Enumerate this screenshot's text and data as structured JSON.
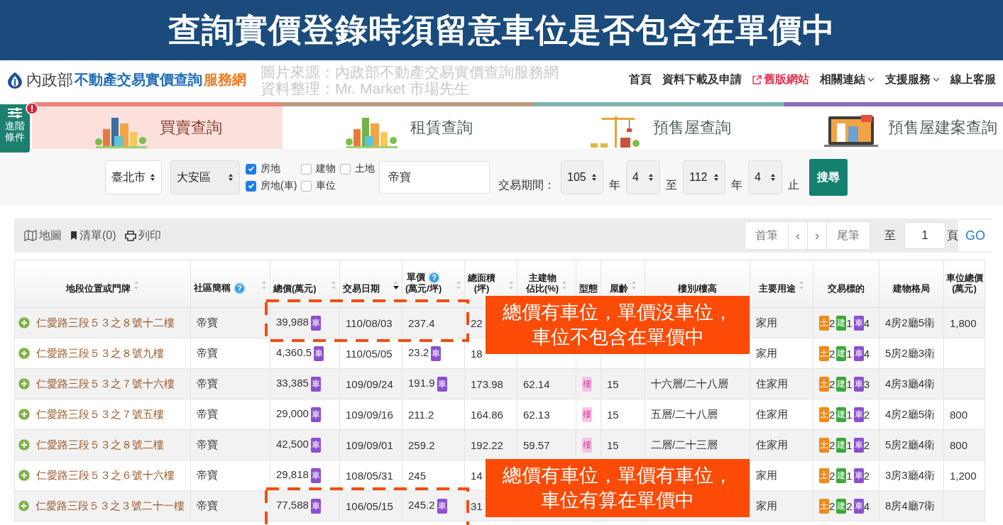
{
  "banner": {
    "title": "查詢實價登錄時須留意車位是否包含在單價中"
  },
  "header": {
    "logo_org": "內政部",
    "logo_main": "不動產交易實價查詢",
    "logo_suffix": "服務網",
    "credits": [
      "圖片來源：內政部不動產交易實價查詢服務網",
      "資料整理：Mr. Market 市場先生"
    ],
    "nav": [
      {
        "label": "首頁",
        "kind": "plain"
      },
      {
        "label": "資料下載及申請",
        "kind": "plain"
      },
      {
        "label": "舊版網站",
        "kind": "external"
      },
      {
        "label": "相關連結",
        "kind": "dropdown"
      },
      {
        "label": "支援服務",
        "kind": "dropdown"
      },
      {
        "label": "線上客服",
        "kind": "plain"
      }
    ]
  },
  "advanced": {
    "label": "進階條件",
    "alert": true
  },
  "tabs": [
    {
      "label": "買賣查詢",
      "selected": true,
      "color": "#e8847c"
    },
    {
      "label": "租賃查詢",
      "selected": false,
      "color": "#b99a7a"
    },
    {
      "label": "預售屋查詢",
      "selected": false,
      "color": "#7fb6ad"
    },
    {
      "label": "預售屋建案查詢",
      "selected": false,
      "color": "#8c6bc0"
    }
  ],
  "form": {
    "city": "臺北市",
    "district": "大安區",
    "types": [
      {
        "label": "房地",
        "checked": true
      },
      {
        "label": "建物",
        "checked": false
      },
      {
        "label": "土地",
        "checked": false
      },
      {
        "label": "房地(車)",
        "checked": true
      },
      {
        "label": "車位",
        "checked": false
      }
    ],
    "keyword": "帝寶",
    "period_label": "交易期間：",
    "from_year": "105",
    "year_unit_1": "年",
    "from_month": "4",
    "to_label": "至",
    "to_year": "112",
    "year_unit_2": "年",
    "to_month": "4",
    "end_label": "止",
    "search_button": "搜尋"
  },
  "toolbar": {
    "map": "地圖",
    "list": "清單(0)",
    "print": "列印",
    "first": "首筆",
    "prev": "‹",
    "next": "›",
    "last": "尾筆",
    "goto_label": "至",
    "page": "1",
    "page_unit": "頁",
    "go": "GO"
  },
  "table": {
    "columns": [
      {
        "lines": [
          "地段位置或門牌"
        ],
        "sortable": true,
        "sorted": false
      },
      {
        "lines": [
          "社區簡稱"
        ],
        "help": "?",
        "sortable": true,
        "sorted": false
      },
      {
        "lines": [
          "總價(萬元)"
        ],
        "sortable": true,
        "sorted": false
      },
      {
        "lines": [
          "交易日期"
        ],
        "sortable": true,
        "sorted": true
      },
      {
        "lines": [
          "單價",
          "(萬元/坪)"
        ],
        "help": "?",
        "sortable": true,
        "sorted": false
      },
      {
        "lines": [
          "總面積",
          "(坪)"
        ],
        "sortable": true,
        "sorted": false
      },
      {
        "lines": [
          "主建物",
          "佔比(%)"
        ],
        "sortable": true,
        "sorted": false
      },
      {
        "lines": [
          "型態"
        ],
        "sortable": false
      },
      {
        "lines": [
          "屋齡"
        ],
        "sortable": true,
        "sorted": false
      },
      {
        "lines": [
          "樓別/樓高"
        ],
        "sortable": false
      },
      {
        "lines": [
          "主要用途"
        ],
        "sortable": true,
        "sorted": false
      },
      {
        "lines": [
          "交易標的"
        ],
        "sortable": false
      },
      {
        "lines": [
          "建物格局"
        ],
        "sortable": false
      },
      {
        "lines": [
          "車位總價",
          "(萬元)"
        ],
        "sortable": false
      }
    ],
    "rows": [
      {
        "address": "仁愛路三段５３之８號十二樓",
        "community": "帝寶",
        "total": "39,988",
        "total_badge": "車",
        "date": "110/08/03",
        "unit": "237.4",
        "area": "22",
        "use": "家用",
        "targets": [
          {
            "label": "土",
            "count": "2",
            "color": "#f08a1c"
          },
          {
            "label": "建",
            "count": "1",
            "color": "#3aa93a"
          },
          {
            "label": "車",
            "count": "4",
            "color": "#8b4fd0"
          }
        ],
        "layout": "4房2廳5衛",
        "parking": "1,800"
      },
      {
        "address": "仁愛路三段５３之８號九樓",
        "community": "帝寶",
        "total": "4,360.5",
        "total_badge": "車",
        "date": "110/05/05",
        "unit": "23.2",
        "unit_badge": "車",
        "area": "18",
        "use": "家用",
        "targets": [
          {
            "label": "土",
            "count": "2",
            "color": "#f08a1c"
          },
          {
            "label": "建",
            "count": "1",
            "color": "#3aa93a"
          },
          {
            "label": "車",
            "count": "4",
            "color": "#8b4fd0"
          }
        ],
        "layout": "5房2廳3衛"
      },
      {
        "address": "仁愛路三段５３之７號十六樓",
        "community": "帝寶",
        "total": "33,385",
        "total_badge": "車",
        "date": "109/09/24",
        "unit": "191.9",
        "unit_badge": "車",
        "area": "173.98",
        "ratio": "62.14",
        "type": "樓",
        "age": "15",
        "floor": "十六層/二十八層",
        "use": "住家用",
        "targets": [
          {
            "label": "土",
            "count": "2",
            "color": "#f08a1c"
          },
          {
            "label": "建",
            "count": "1",
            "color": "#3aa93a"
          },
          {
            "label": "車",
            "count": "3",
            "color": "#8b4fd0"
          }
        ],
        "layout": "4房3廳4衛"
      },
      {
        "address": "仁愛路三段５３之７號五樓",
        "community": "帝寶",
        "total": "29,000",
        "total_badge": "車",
        "date": "109/09/16",
        "unit": "211.2",
        "area": "164.86",
        "ratio": "62.13",
        "type": "樓",
        "age": "15",
        "floor": "五層/二十八層",
        "use": "住家用",
        "targets": [
          {
            "label": "土",
            "count": "2",
            "color": "#f08a1c"
          },
          {
            "label": "建",
            "count": "1",
            "color": "#3aa93a"
          },
          {
            "label": "車",
            "count": "2",
            "color": "#8b4fd0"
          }
        ],
        "layout": "4房2廳5衛",
        "parking": "800"
      },
      {
        "address": "仁愛路三段５３之８號二樓",
        "community": "帝寶",
        "total": "42,500",
        "total_badge": "車",
        "date": "109/09/01",
        "unit": "259.2",
        "area": "192.22",
        "ratio": "59.57",
        "type": "樓",
        "age": "15",
        "floor": "二層/二十三層",
        "use": "住家用",
        "targets": [
          {
            "label": "土",
            "count": "2",
            "color": "#f08a1c"
          },
          {
            "label": "建",
            "count": "1",
            "color": "#3aa93a"
          },
          {
            "label": "車",
            "count": "2",
            "color": "#8b4fd0"
          }
        ],
        "layout": "5房2廳4衛",
        "parking": "800"
      },
      {
        "address": "仁愛路三段５３之６號十六樓",
        "community": "帝寶",
        "total": "29,818",
        "total_badge": "車",
        "date": "108/05/31",
        "unit": "245",
        "area": "14",
        "use": "家用",
        "targets": [
          {
            "label": "土",
            "count": "2",
            "color": "#f08a1c"
          },
          {
            "label": "建",
            "count": "1",
            "color": "#3aa93a"
          },
          {
            "label": "車",
            "count": "2",
            "color": "#8b4fd0"
          }
        ],
        "layout": "3房3廳4衛",
        "parking": "1,200"
      },
      {
        "address": "仁愛路三段５３之３號二十一樓",
        "community": "帝寶",
        "total": "77,588",
        "total_badge": "車",
        "date": "106/05/15",
        "unit": "245.2",
        "unit_badge": "車",
        "area": "31",
        "use": "家用",
        "targets": [
          {
            "label": "土",
            "count": "2",
            "color": "#f08a1c"
          },
          {
            "label": "建",
            "count": "2",
            "color": "#3aa93a"
          },
          {
            "label": "車",
            "count": "4",
            "color": "#8b4fd0"
          }
        ],
        "layout": "8房4廳7衛"
      }
    ]
  },
  "callouts": [
    {
      "lines": [
        "總價有車位，單價沒車位，",
        "車位不包含在單價中"
      ]
    },
    {
      "lines": [
        "總價有車位，單價有車位，",
        "車位有算在單價中"
      ]
    }
  ]
}
